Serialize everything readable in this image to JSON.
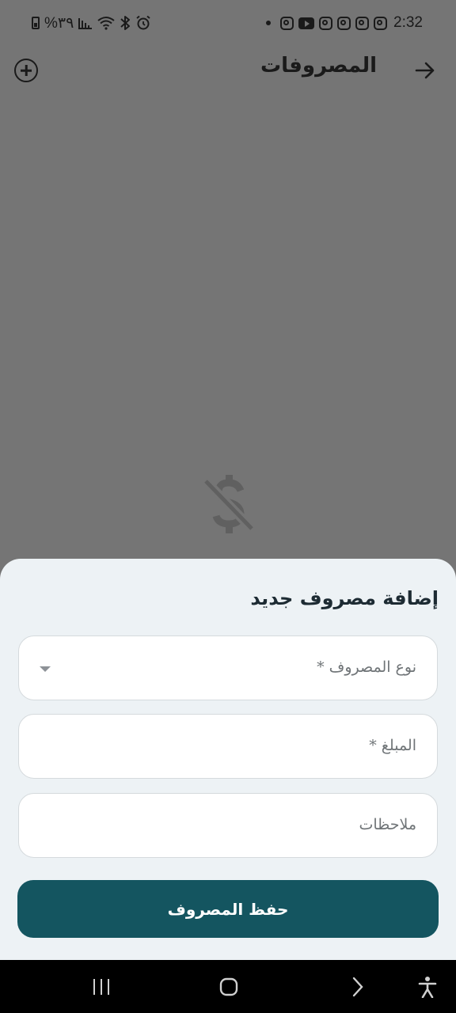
{
  "status_bar": {
    "time": "2:32",
    "battery": "%٣٩"
  },
  "app_bar": {
    "title": "المصروفات"
  },
  "sheet": {
    "title": "إضافة مصروف جديد",
    "type_field": {
      "placeholder": "نوع المصروف *"
    },
    "amount_field": {
      "placeholder": "المبلغ *"
    },
    "notes_field": {
      "placeholder": "ملاحظات"
    },
    "save_label": "حفظ المصروف"
  },
  "colors": {
    "scrim": "#757575",
    "sheet_bg": "#edf2f5",
    "primary": "#145560"
  }
}
